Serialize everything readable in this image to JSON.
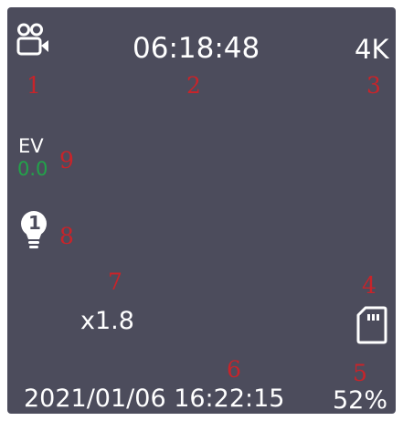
{
  "hud": {
    "record_mode_icon": "video-camera-icon",
    "timer": "06:18:48",
    "resolution": "4K",
    "sd_card_icon": "sd-card-icon",
    "battery": "52%",
    "datetime": "2021/01/06 16:22:15",
    "zoom": "x1.8",
    "light_icon": "bulb-icon",
    "light_level": "1",
    "ev_label": "EV",
    "ev_value": "0.0"
  },
  "callouts": [
    "1",
    "2",
    "3",
    "4",
    "5",
    "6",
    "7",
    "8",
    "9"
  ],
  "colors": {
    "background": "#4c4c5c",
    "text": "#ffffff",
    "ev_value": "#22a34a",
    "callout": "#c8242a"
  }
}
